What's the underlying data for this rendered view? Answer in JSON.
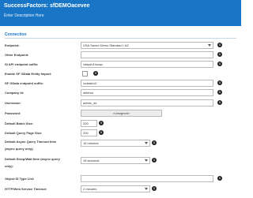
{
  "header": {
    "title": "SuccessFactors: sfDEMOacevee",
    "description": "Enter Description Here"
  },
  "section": {
    "title": "Connection"
  },
  "fields": {
    "endpoint": {
      "label": "Endpoint:",
      "value": "USA Saved Demo Standard \\ AZ"
    },
    "other_endpoint": {
      "label": "Other Endpoint:",
      "value": ""
    },
    "si_api_suffix": {
      "label": "SI API endpoint suffix:",
      "value": "/sfapi/v1/soap"
    },
    "enable_odata": {
      "label": "Enable SF OData Entity Import:",
      "checked": false
    },
    "odata_suffix": {
      "label": "SF OData endpoint suffix:",
      "value": "/odata/v2/"
    },
    "company_id": {
      "label": "Company Id:",
      "value": "sfdemo"
    },
    "username": {
      "label": "Username:",
      "value": "admin_ds"
    },
    "password": {
      "label": "Password:",
      "button": "<Unsigned>"
    },
    "batch_size": {
      "label": "Default Batch Size:",
      "value": "200"
    },
    "query_page_size": {
      "label": "Default Query Page Size:",
      "value": "200"
    },
    "async_timeout": {
      "label": "Default Async Query Timeout time",
      "label2": "(async query only):",
      "value": "15 minutes"
    },
    "sleep_wait": {
      "label": "Default Sleep/Wait time (async query",
      "label2": "only):",
      "value": "15 seconds"
    },
    "object_id_type": {
      "label": "Object ID Type List:",
      "value": ""
    },
    "http_timeout": {
      "label": "HTTP/Web Service Timeout:",
      "value": "2 minutes"
    }
  },
  "icons": {
    "info": "info-icon",
    "dropdown": "chevron-down-icon"
  },
  "colors": {
    "header": "#1976c6",
    "section": "#1976c6"
  }
}
